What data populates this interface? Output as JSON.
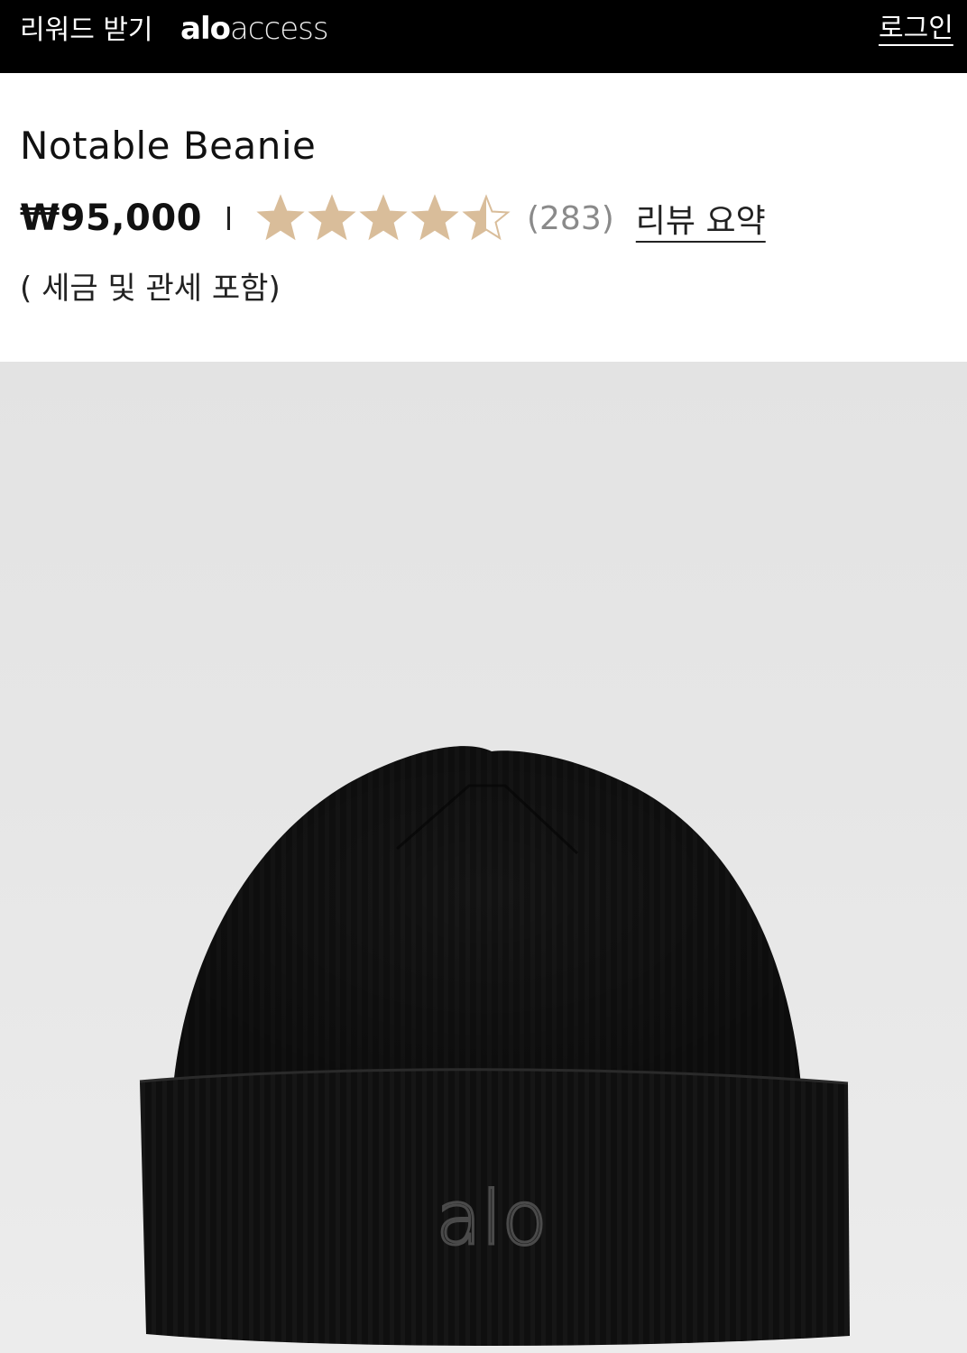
{
  "topbar": {
    "reward_label": "리워드 받기",
    "brand_alo": "alo",
    "brand_access": "access",
    "login_label": "로그인"
  },
  "product": {
    "title": "Notable Beanie",
    "price": "₩95,000",
    "rating": 4.5,
    "rating_max": 5,
    "review_count": "(283)",
    "review_summary_label": "리뷰 요약",
    "tax_note": "( 세금 및 관세 포함)",
    "embroidery": "alo"
  },
  "colors": {
    "star_fill": "#d9bd9a",
    "topbar_bg": "#000000",
    "image_bg": "#e5e5e5",
    "beanie": "#121212"
  },
  "icons": {
    "star": "star-icon",
    "half_star": "half-star-icon"
  }
}
